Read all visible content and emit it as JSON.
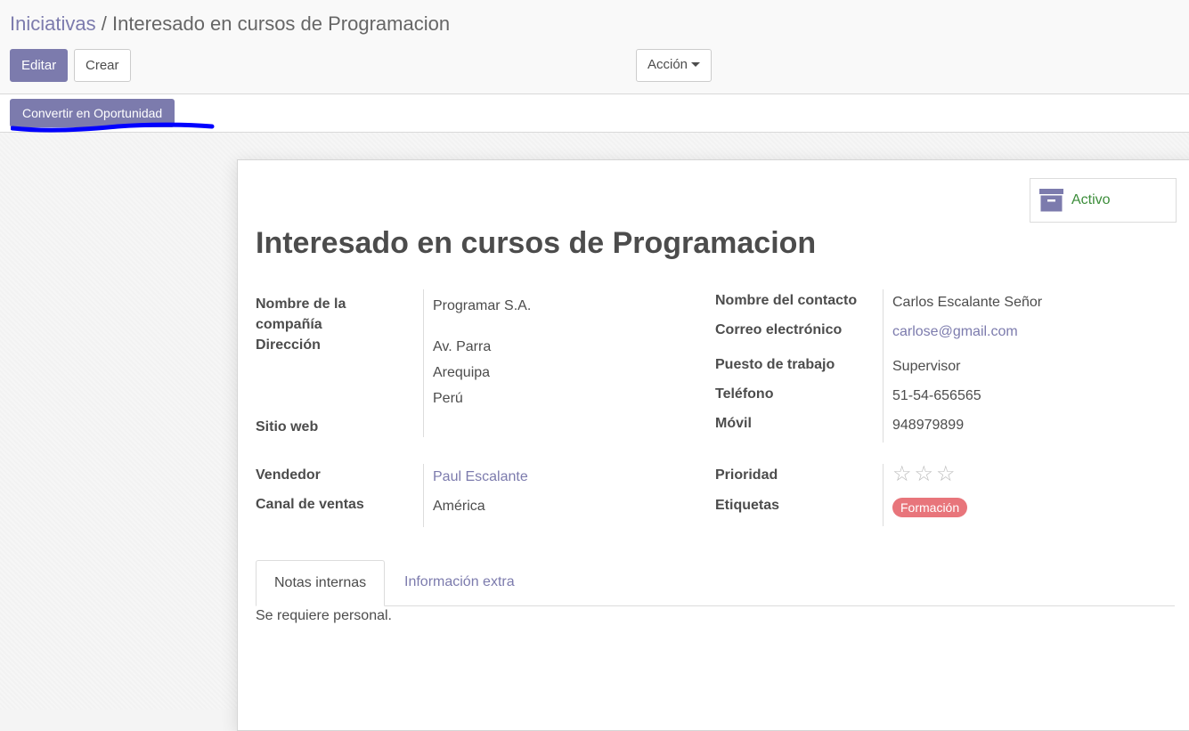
{
  "breadcrumb": {
    "parent": "Iniciativas",
    "separator": "/",
    "current": "Interesado en cursos de Programacion"
  },
  "toolbar": {
    "edit_label": "Editar",
    "create_label": "Crear",
    "action_label": "Acción"
  },
  "statusbar": {
    "convert_label": "Convertir en Oportunidad",
    "underline_color": "#0000ff"
  },
  "record": {
    "active_label": "Activo",
    "active_icon": "archive-icon",
    "title": "Interesado en cursos de Programacion"
  },
  "fields": {
    "company_name": {
      "label_line1": "Nombre de la",
      "label_line2": "compañía",
      "value": "Programar S.A."
    },
    "address": {
      "label": "Dirección",
      "street": "Av. Parra",
      "city": "Arequipa",
      "country": "Perú"
    },
    "website": {
      "label": "Sitio web",
      "value": ""
    },
    "contact_name": {
      "label": "Nombre del contacto",
      "value": "Carlos Escalante Señor"
    },
    "email": {
      "label": "Correo electrónico",
      "value": "carlose@gmail.com"
    },
    "job_position": {
      "label": "Puesto de trabajo",
      "value": "Supervisor"
    },
    "phone": {
      "label": "Teléfono",
      "value": "51-54-656565"
    },
    "mobile": {
      "label": "Móvil",
      "value": "948979899"
    },
    "salesperson": {
      "label": "Vendedor",
      "value": "Paul Escalante"
    },
    "sales_channel": {
      "label": "Canal de ventas",
      "value": "América"
    },
    "priority": {
      "label": "Prioridad",
      "stars_filled": 0,
      "stars_total": 3
    },
    "tags": {
      "label": "Etiquetas",
      "values": [
        "Formación"
      ],
      "tag_color": "#e8757b"
    }
  },
  "tabs": {
    "internal_notes": "Notas internas",
    "extra_info": "Información extra",
    "active_tab": "internal_notes"
  },
  "notes": {
    "content": "Se requiere personal."
  },
  "colors": {
    "accent": "#7c7bad",
    "active_status": "#3c8d3a"
  }
}
